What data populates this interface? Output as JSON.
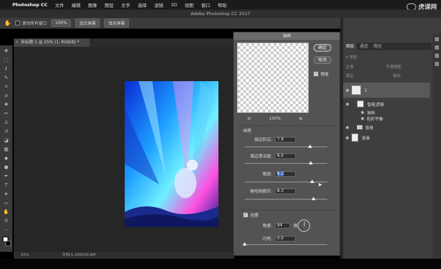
{
  "menubar": {
    "apple": "",
    "items": [
      "Photoshop CC",
      "文件",
      "编辑",
      "图像",
      "图层",
      "文字",
      "选择",
      "滤镜",
      "3D",
      "视图",
      "窗口",
      "帮助"
    ],
    "watermark": "虎课网"
  },
  "titlebar": {
    "title": "Adobe Photoshop CC 2017"
  },
  "options": {
    "scroll_all_label": "滚动所有窗口",
    "btn_100": "100%",
    "btn_fit": "适合屏幕",
    "btn_fill": "填充屏幕"
  },
  "document_tab": {
    "title": "未标题-1 @ 25% (1, RGB/8) *",
    "close": "×"
  },
  "status": {
    "zoom": "25%",
    "doc": "文档:5.25M/20.6M"
  },
  "dialog": {
    "title": "油画",
    "ok": "确定",
    "cancel": "取消",
    "preview_label": "预览",
    "zoom_out": "⊖",
    "zoom_value": "100%",
    "zoom_in": "⊕",
    "brush_section": "画笔",
    "stylization_label": "描边样式:",
    "stylization_value": "7.9",
    "cleanliness_label": "描边清洁度:",
    "cleanliness_value": "8.0",
    "scale_label": "缩放:",
    "scale_value": "8.2",
    "bristle_label": "硬毛刷细节:",
    "bristle_value": "8.3",
    "lighting_section": "光照",
    "angle_label": "角度:",
    "angle_value": "94",
    "angle_unit": "度",
    "shine_label": "闪亮:",
    "shine_value": "0.0",
    "sliders": {
      "stylization": 0.79,
      "cleanliness": 0.8,
      "scale": 0.82,
      "bristle": 0.83,
      "shine": 0.0
    }
  },
  "layers_panel": {
    "tabs": [
      "图层",
      "通道",
      "路径"
    ],
    "kind_label": "P 类型",
    "blend_mode": "正常",
    "opacity_label": "不透明度:",
    "lock_label": "锁定:",
    "fill_label": "填充:",
    "layers": [
      {
        "name": "1"
      },
      {
        "name": "智能滤镜"
      },
      {
        "name": "油画"
      },
      {
        "name": "色彩平衡"
      },
      {
        "name": "背景"
      },
      {
        "name": "背景"
      }
    ]
  }
}
